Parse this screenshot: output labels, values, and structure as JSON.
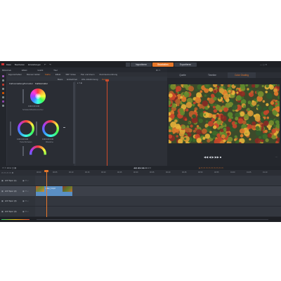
{
  "menu": [
    "Datei",
    "Bearbeiten",
    "Einstellungen",
    "Hilfe"
  ],
  "modes": [
    "Importieren",
    "Bearbeiten",
    "Exportieren"
  ],
  "active_mode": 1,
  "panel_tabs": [
    "Bibliothek",
    "Effekt",
    "Grafik",
    "Titel"
  ],
  "editor_tabs": [
    "Eigenschaften",
    "Manuel. Editor",
    "Farbe",
    "Effekt",
    "360°-Video",
    "Pan und Zoom",
    "Zeit-Neuzuordnung"
  ],
  "sub_tabs": [
    "Basis",
    "Einfachheit",
    "HSL-Abstimmung",
    "Kurven"
  ],
  "color_section": "Farbverwaltung/Korrektur",
  "color_tab": "Farbkorrektur",
  "wheel_labels": {
    "main": "Schatten/Mitteltöne/Lichter",
    "left": "Tiefen/Schatten",
    "right": "Mitteltöne",
    "bottom": "Glanzlichter"
  },
  "wheel_values": {
    "main": "0.00   0.00   0.00",
    "left": "0.00   0.00   0.00",
    "right": "0.00   0.00   0.00",
    "bottom": "0.00   0.00   0.00"
  },
  "monitor_tabs": [
    "Quelle",
    "Timeline",
    "Color Grading"
  ],
  "active_monitor_tab": 2,
  "transport_glyphs": "◀◀  ◀  ▶  ▶▶  ■",
  "tracks": [
    {
      "name": "A/V Spur (1)"
    },
    {
      "name": "A/V Spur (2)"
    },
    {
      "name": "A/V Spur (3)"
    },
    {
      "name": "A/V Spur (4)"
    }
  ],
  "selected_track": 1,
  "clip_label": "video_3.mp4",
  "ruler_ticks": [
    "00:00",
    "00:05",
    "00:10",
    "00:15",
    "00:20",
    "00:25",
    "00:30",
    "00:35",
    "00:40",
    "00:45",
    "00:50",
    "00:55",
    "01:00",
    "01:05",
    "01:10"
  ],
  "colors": {
    "accent": "#e8782a",
    "clip": "#5a8fc4",
    "playhead": "#e8782a"
  }
}
